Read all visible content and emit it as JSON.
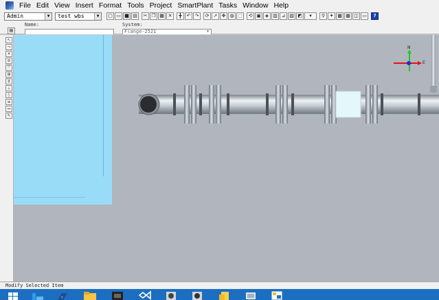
{
  "menu": {
    "items": [
      "File",
      "Edit",
      "View",
      "Insert",
      "Format",
      "Tools",
      "Project",
      "SmartPlant",
      "Tasks",
      "Window",
      "Help"
    ]
  },
  "toolbar": {
    "user_combo_value": "Admin",
    "workspace_combo_value": "test wbs",
    "icons": [
      "new-file-icon",
      "open-icon",
      "save-icon",
      "print-icon",
      "cut-icon",
      "copy-icon",
      "paste-icon",
      "delete-icon",
      "measure-icon",
      "undo-icon",
      "redo-icon",
      "refresh-icon",
      "select-icon",
      "pan-icon",
      "zoom-icon",
      "zoom-area-icon",
      "rotate-icon",
      "view-front-icon",
      "view-iso-icon",
      "view-top-icon",
      "walk-icon",
      "clip-icon",
      "render-icon",
      "properties-icon",
      "filter-icon",
      "help-icon"
    ]
  },
  "properties": {
    "name_label": "Name:",
    "system_label": "System:",
    "system_value": "Flange-2521"
  },
  "vertical_toolbar": {
    "icons": [
      "select-tool-icon",
      "route-tool-icon",
      "insert-component-icon",
      "connect-icon",
      "split-icon",
      "nozzle-icon",
      "valve-icon",
      "support-icon",
      "weld-icon",
      "spec-icon",
      "dimension-icon",
      "note-icon"
    ]
  },
  "graphic_view": {
    "compass_north": "N",
    "compass_east": "E",
    "panel_color": "#99dcf7",
    "background_color": "#b1b5bd"
  },
  "status": {
    "text": "Modify Selected Item"
  },
  "taskbar": {
    "color": "#1c6fc0",
    "apps": [
      "start-icon",
      "server-manager-icon",
      "powershell-icon",
      "file-explorer-icon",
      "smart3d-icon",
      "visual-studio-icon",
      "app-icon-1",
      "app-icon-2",
      "sticky-notes-icon",
      "control-panel-icon",
      "smartplant-icon"
    ]
  }
}
